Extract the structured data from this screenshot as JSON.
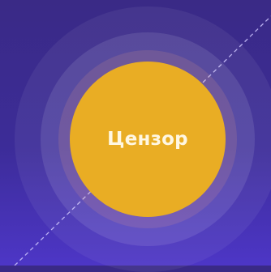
{
  "bubble": {
    "label": "Цензор",
    "core_color": "#e9ad24"
  },
  "background": {
    "top_color": "#3a2a86",
    "bottom_color": "#4d36c6"
  },
  "decoration": {
    "line_style": "dashed",
    "line_color": "#cfc7ff"
  }
}
